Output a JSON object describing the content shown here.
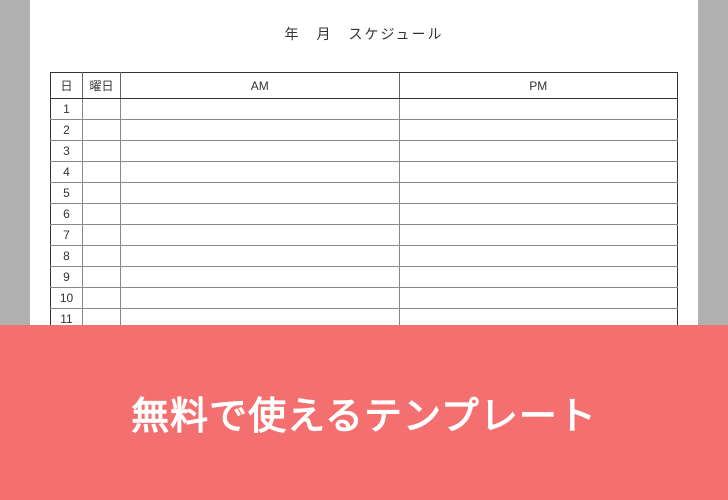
{
  "title": "年　月　スケジュール",
  "headers": {
    "day": "日",
    "weekday": "曜日",
    "am": "AM",
    "pm": "PM"
  },
  "rows": [
    {
      "day": "1",
      "weekday": "",
      "am": "",
      "pm": ""
    },
    {
      "day": "2",
      "weekday": "",
      "am": "",
      "pm": ""
    },
    {
      "day": "3",
      "weekday": "",
      "am": "",
      "pm": ""
    },
    {
      "day": "4",
      "weekday": "",
      "am": "",
      "pm": ""
    },
    {
      "day": "5",
      "weekday": "",
      "am": "",
      "pm": ""
    },
    {
      "day": "6",
      "weekday": "",
      "am": "",
      "pm": ""
    },
    {
      "day": "7",
      "weekday": "",
      "am": "",
      "pm": ""
    },
    {
      "day": "8",
      "weekday": "",
      "am": "",
      "pm": ""
    },
    {
      "day": "9",
      "weekday": "",
      "am": "",
      "pm": ""
    },
    {
      "day": "10",
      "weekday": "",
      "am": "",
      "pm": ""
    },
    {
      "day": "11",
      "weekday": "",
      "am": "",
      "pm": ""
    }
  ],
  "banner": {
    "text": "無料で使えるテンプレート"
  },
  "colors": {
    "banner_bg": "#f47070",
    "banner_text": "#ffffff",
    "page_bg": "#ffffff",
    "outer_bg": "#b0b0b0"
  }
}
